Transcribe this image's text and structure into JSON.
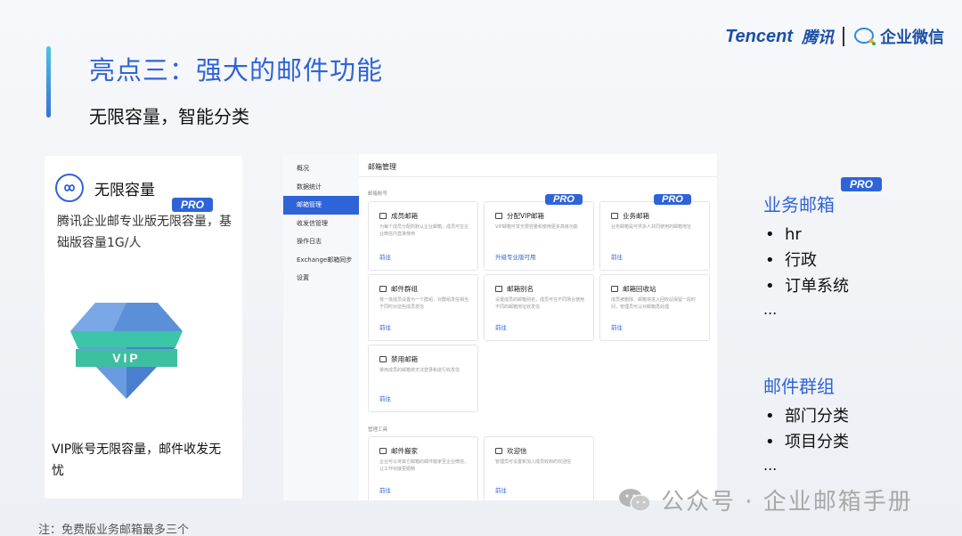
{
  "slide": {
    "title": "亮点三：强大的邮件功能",
    "subtitle": "无限容量，智能分类",
    "note": "注：免费版业务邮箱最多三个"
  },
  "brand": {
    "tencent": "Tencent",
    "tencent_cn": "腾讯",
    "wework": "企业微信"
  },
  "left_card": {
    "title": "无限容量",
    "pro": "PRO",
    "desc": "腾讯企业邮专业版无限容量，基础版容量1G/人",
    "gem_label": "VIP",
    "bottom": "VIP账号无限容量，邮件收发无忧"
  },
  "mock": {
    "sidebar": [
      {
        "label": "概况",
        "active": false
      },
      {
        "label": "数据统计",
        "active": false
      },
      {
        "label": "邮箱管理",
        "active": true
      },
      {
        "label": "收发信管理",
        "active": false
      },
      {
        "label": "操作日志",
        "active": false
      },
      {
        "label": "Exchange邮箱同步",
        "active": false
      },
      {
        "label": "设置",
        "active": false
      }
    ],
    "title": "邮箱管理",
    "section_accounts": "邮箱帐号",
    "section_tools": "管理工具",
    "tiles": [
      {
        "title": "成员邮箱",
        "desc": "为每个成员分配的默认企业邮箱，成员可在企业微信内直接使用",
        "link": "前往"
      },
      {
        "title": "分配VIP邮箱",
        "desc": "VIP邮箱可享无限容量和使用更多高级功能",
        "link": "升级专业版可用",
        "pro": "PRO"
      },
      {
        "title": "业务邮箱",
        "desc": "业务邮箱是可供多人共同使用的邮箱地址",
        "link": "前往",
        "pro": "PRO"
      },
      {
        "title": "邮件群组",
        "desc": "将一批成员设置为一个群组，对群组发信相当于同时对这些成员发信",
        "link": "前往"
      },
      {
        "title": "邮箱别名",
        "desc": "设置成员的邮箱别名，成员可在不同场合使用不同的邮箱地址收发信",
        "link": "前往"
      },
      {
        "title": "邮箱回收站",
        "desc": "成员被删除、邮箱将进入回收站保留一段时间，管理员可以对邮箱再处理",
        "link": "前往"
      },
      {
        "title": "禁用邮箱",
        "desc": "禁用成员的邮箱将无法登录和进行收发信",
        "link": "前往"
      },
      {
        "title": "邮件搬家",
        "desc": "企业可以将其它邮箱的邮件搬家至企业微信，让工作衔接更顺畅",
        "link": "前往"
      },
      {
        "title": "欢迎信",
        "desc": "管理员可设置新加入成员收到的欢迎信",
        "link": "前往"
      }
    ]
  },
  "right": {
    "pro": "PRO",
    "business": {
      "title": "业务邮箱",
      "items": [
        "hr",
        "行政",
        "订单系统"
      ],
      "more": "..."
    },
    "group": {
      "title": "邮件群组",
      "items": [
        "部门分类",
        "项目分类"
      ],
      "more": "..."
    }
  },
  "watermark": {
    "text": "公众号 · 企业邮箱手册"
  },
  "colors": {
    "accent": "#2f64d8",
    "brand": "#1c4fa6"
  }
}
